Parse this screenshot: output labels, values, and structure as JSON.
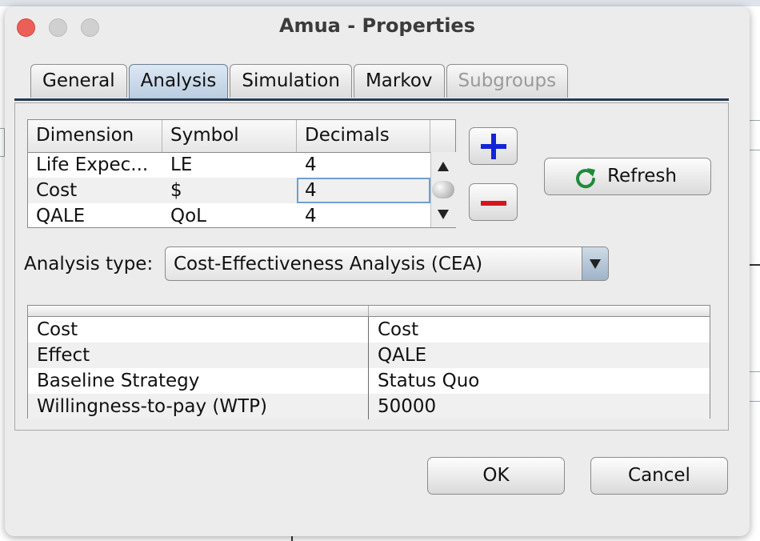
{
  "window": {
    "title": "Amua - Properties"
  },
  "tabs": [
    {
      "label": "General",
      "state": "normal"
    },
    {
      "label": "Analysis",
      "state": "active"
    },
    {
      "label": "Simulation",
      "state": "normal"
    },
    {
      "label": "Markov",
      "state": "normal"
    },
    {
      "label": "Subgroups",
      "state": "disabled"
    }
  ],
  "dimensions": {
    "headers": [
      "Dimension",
      "Symbol",
      "Decimals"
    ],
    "rows": [
      [
        "Life Expec...",
        "LE",
        "4"
      ],
      [
        "Cost",
        "$",
        "4"
      ],
      [
        "QALE",
        "QoL",
        "4"
      ]
    ]
  },
  "buttons": {
    "add_icon": "plus-icon",
    "remove_icon": "minus-icon",
    "refresh_label": "Refresh",
    "refresh_icon": "refresh-icon",
    "ok_label": "OK",
    "cancel_label": "Cancel"
  },
  "analysis_type": {
    "label": "Analysis type:",
    "selected": "Cost-Effectiveness Analysis (CEA)"
  },
  "properties": {
    "rows": [
      [
        "Cost",
        "Cost"
      ],
      [
        "Effect",
        "QALE"
      ],
      [
        "Baseline Strategy",
        "Status Quo"
      ],
      [
        "Willingness-to-pay (WTP)",
        "50000"
      ]
    ]
  },
  "colors": {
    "close": "#ec5f57",
    "plus": "#1326d6",
    "minus": "#d4161d",
    "refresh": "#1e8a3a",
    "tab_rule": "#243a55"
  }
}
